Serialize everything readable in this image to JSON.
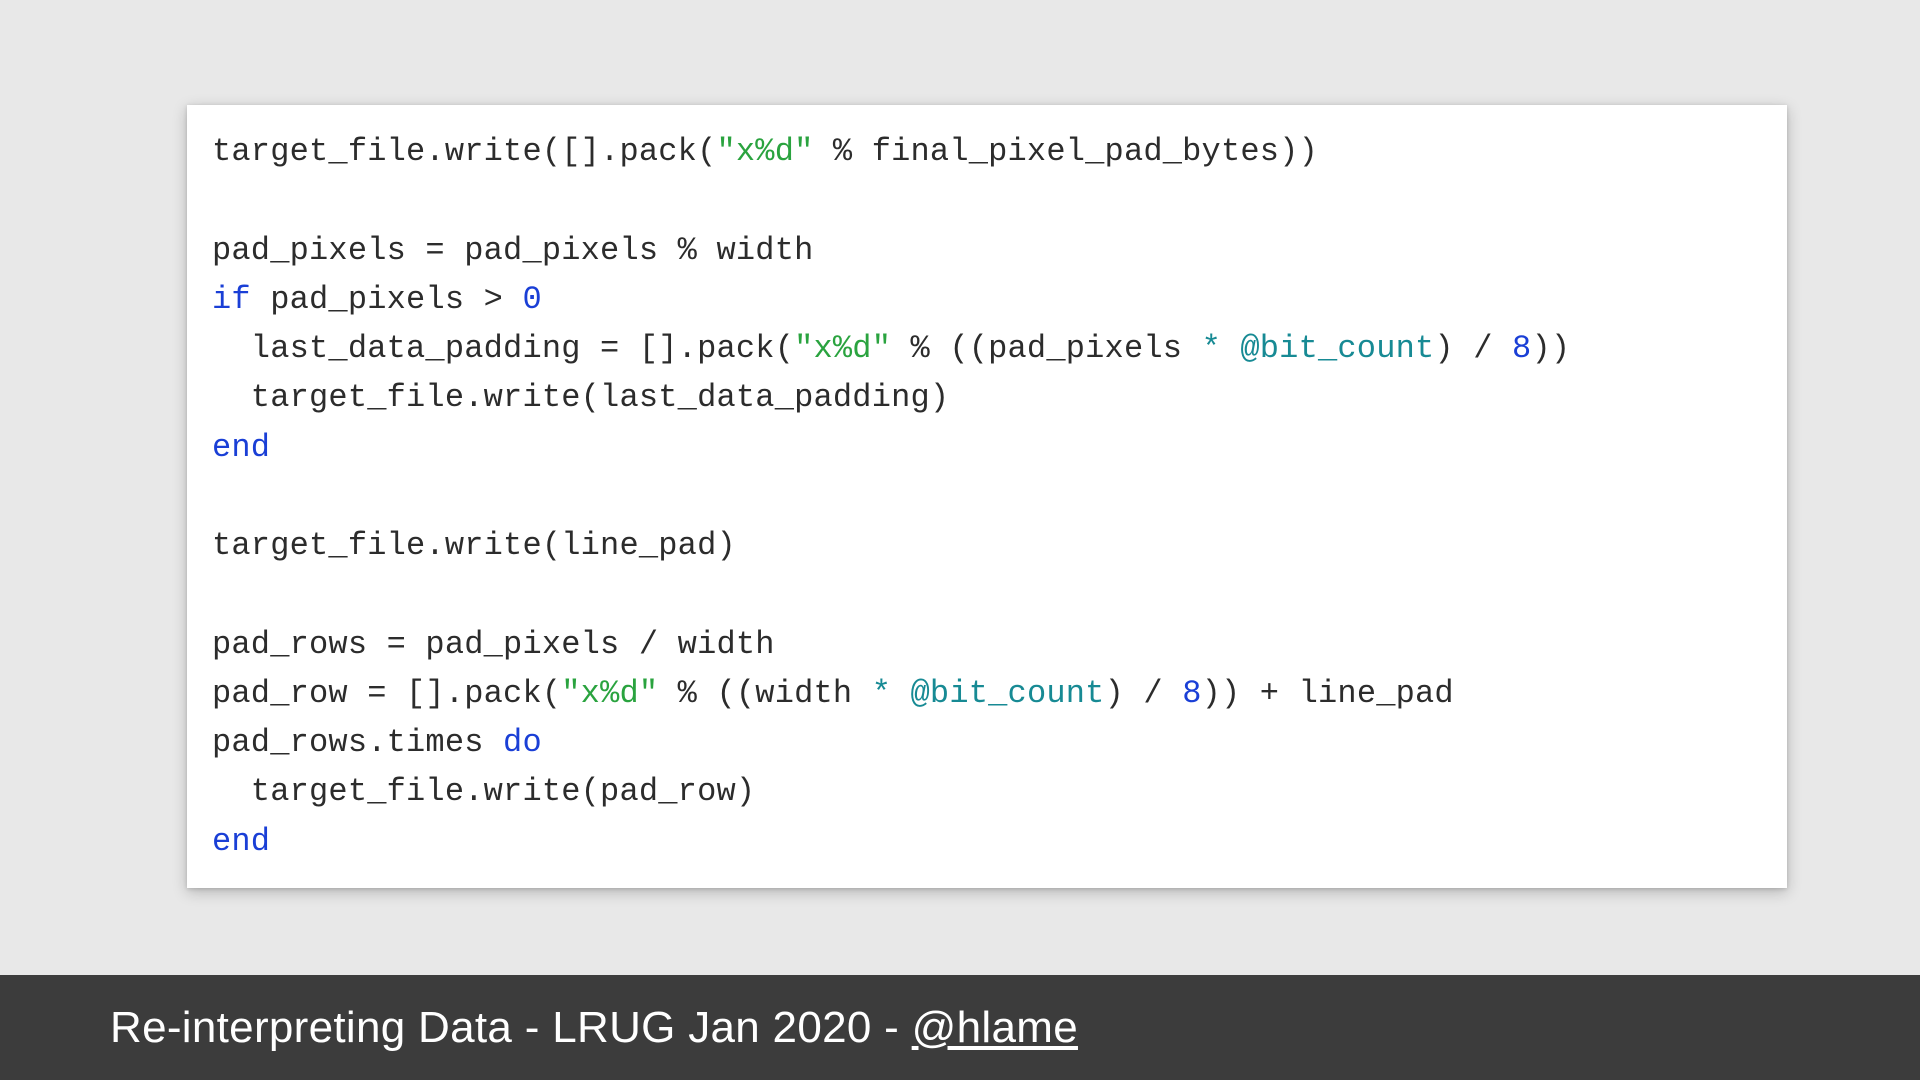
{
  "code": {
    "l1_a": "target_file.write([].pack(",
    "l1_str": "\"x%d\"",
    "l1_b": " % final_pixel_pad_bytes))",
    "l3": "pad_pixels = pad_pixels % width",
    "l4_if": "if",
    "l4_a": " pad_pixels > ",
    "l4_zero": "0",
    "l5_a": "  last_data_padding = [].pack(",
    "l5_str": "\"x%d\"",
    "l5_b": " % ((pad_pixels ",
    "l5_star": "*",
    "l5_c": " ",
    "l5_ivar": "@bit_count",
    "l5_d": ") / ",
    "l5_eight": "8",
    "l5_e": "))",
    "l6": "  target_file.write(last_data_padding)",
    "l7_end": "end",
    "l9": "target_file.write(line_pad)",
    "l11": "pad_rows = pad_pixels / width",
    "l12_a": "pad_row = [].pack(",
    "l12_str": "\"x%d\"",
    "l12_b": " % ((width ",
    "l12_star": "*",
    "l12_c": " ",
    "l12_ivar": "@bit_count",
    "l12_d": ") / ",
    "l12_eight": "8",
    "l12_e": ")) + line_pad",
    "l13_a": "pad_rows.times ",
    "l13_do": "do",
    "l14": "  target_file.write(pad_row)",
    "l15_end": "end"
  },
  "footer": {
    "title": "Re-interpreting Data",
    "sep": " - ",
    "event": "LRUG Jan 2020",
    "handle": "@hlame"
  }
}
